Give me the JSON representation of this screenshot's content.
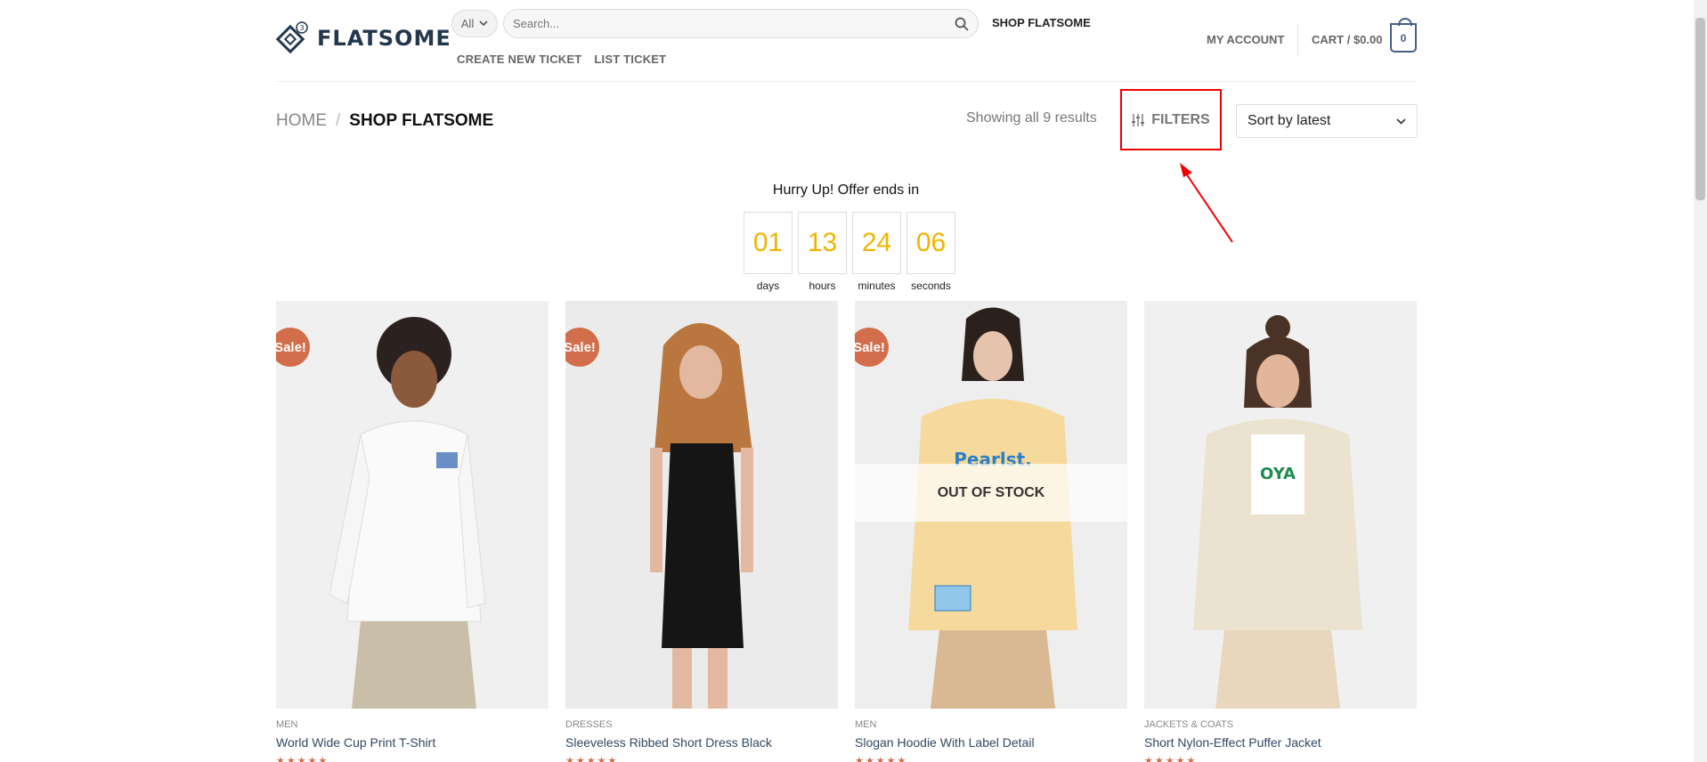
{
  "header": {
    "logo_text": "FLATSOME",
    "logo_badge": "3",
    "category_select": "All",
    "search_placeholder": "Search...",
    "nav_shop": "SHOP FLATSOME",
    "sub_nav": [
      "CREATE NEW TICKET",
      "LIST TICKET"
    ],
    "account_label": "MY ACCOUNT",
    "cart_label": "CART / $0.00",
    "cart_count": "0"
  },
  "breadcrumb": {
    "home": "HOME",
    "separator": "/",
    "current": "SHOP FLATSOME"
  },
  "toolbar": {
    "results_text": "Showing all 9 results",
    "filters_label": "FILTERS",
    "sort_value": "Sort by latest"
  },
  "countdown": {
    "title": "Hurry Up! Offer ends in",
    "units": [
      {
        "value": "01",
        "label": "days"
      },
      {
        "value": "13",
        "label": "hours"
      },
      {
        "value": "24",
        "label": "minutes"
      },
      {
        "value": "06",
        "label": "seconds"
      }
    ]
  },
  "products": [
    {
      "category": "MEN",
      "name": "World Wide Cup Print T-Shirt",
      "badge": "Sale!",
      "overlay": "",
      "stars": "★★★★★"
    },
    {
      "category": "DRESSES",
      "name": "Sleeveless Ribbed Short Dress Black",
      "badge": "Sale!",
      "overlay": "",
      "stars": "★★★★★"
    },
    {
      "category": "MEN",
      "name": "Slogan Hoodie With Label Detail",
      "badge": "Sale!",
      "overlay": "OUT OF STOCK",
      "stars": "★★★★★"
    },
    {
      "category": "JACKETS & COATS",
      "name": "Short Nylon-Effect Puffer Jacket",
      "badge": "",
      "overlay": "",
      "stars": "★★★★★"
    }
  ],
  "colors": {
    "brand": "#446084",
    "sale": "#d26e4b",
    "timer": "#f0b400",
    "highlight": "#e00000"
  },
  "icons": [
    "search-icon",
    "chevron-down-icon",
    "filter-icon",
    "cart-icon"
  ]
}
